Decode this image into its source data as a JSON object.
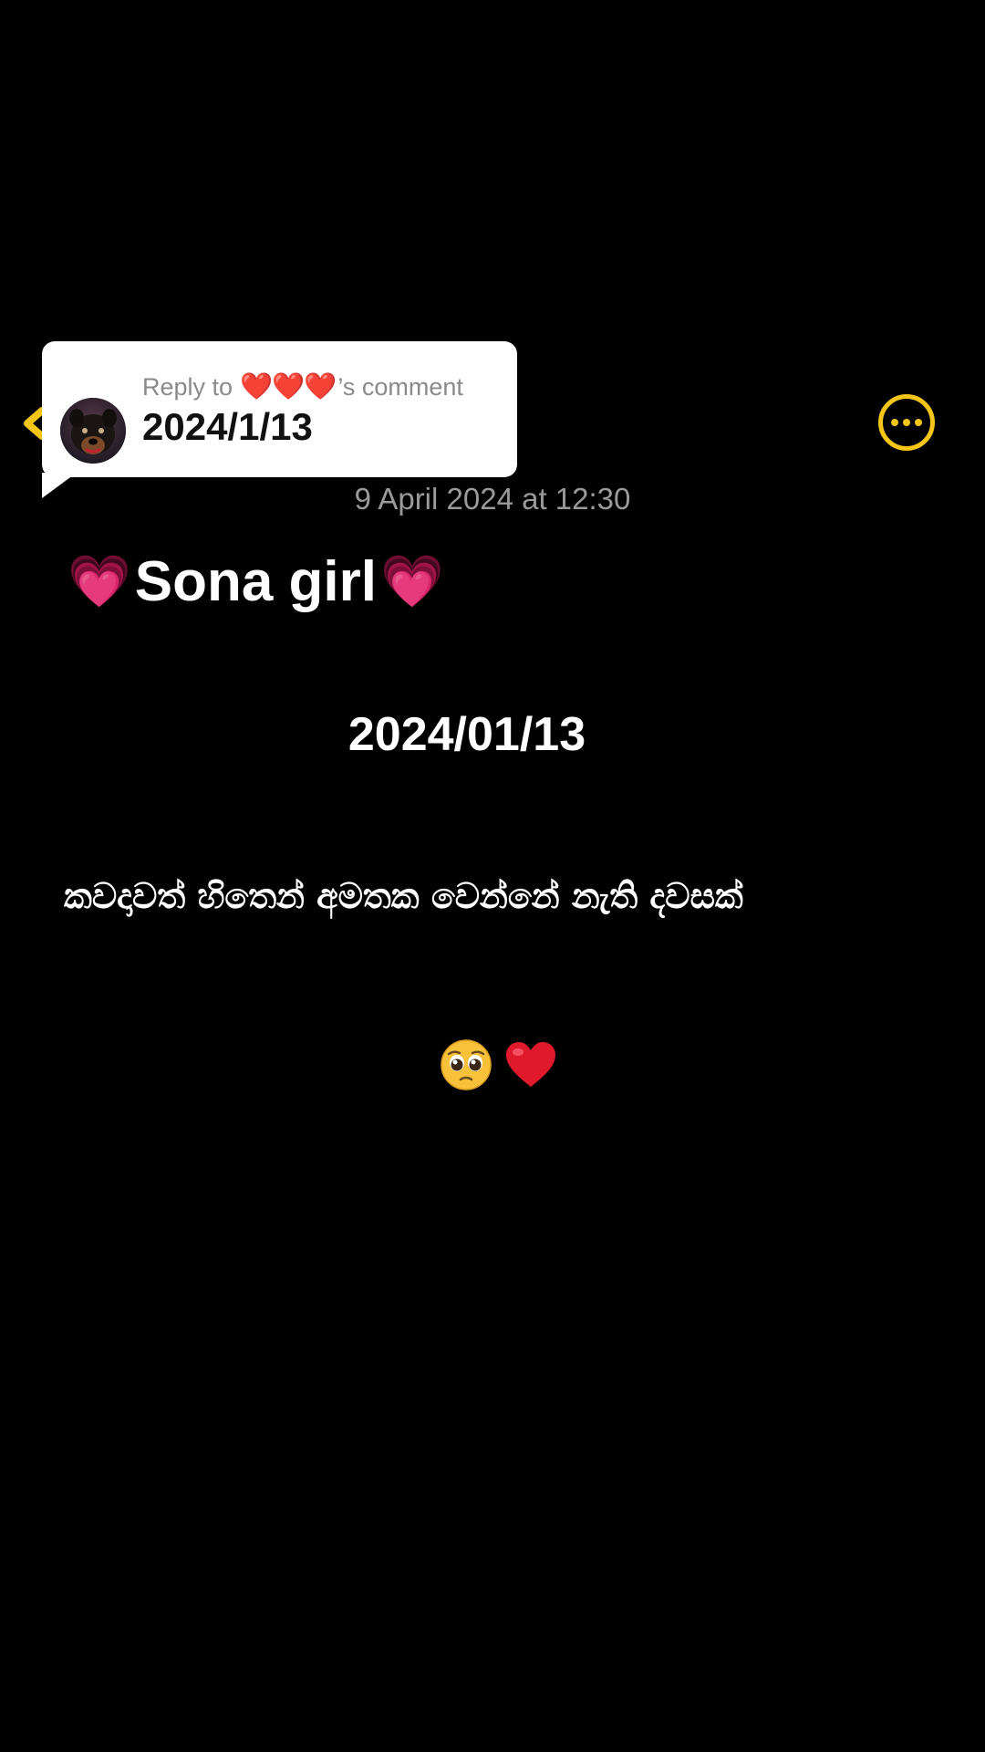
{
  "reply": {
    "prefix": "Reply to",
    "author_emoji": "❤️❤️❤️",
    "suffix": "’s comment",
    "comment_text": "2024/1/13"
  },
  "post": {
    "timestamp": "9 April 2024 at 12:30",
    "title_emoji": "💗",
    "title": "Sona girl",
    "date": "2024/01/13",
    "body": "කවදාවත් හිතෙන් අමතක වෙන්නේ නැති දවසක්",
    "emojis": "🥺❤️"
  },
  "icons": {
    "back": "chevron-left-icon",
    "more": "more-horizontal-icon",
    "avatar": "dog-avatar"
  },
  "colors": {
    "background": "#000000",
    "accent": "#f5c518",
    "card": "#ffffff",
    "muted": "#9a9a9a",
    "heart_pink": "#ff4fa8",
    "heart_red": "#e0192d"
  }
}
